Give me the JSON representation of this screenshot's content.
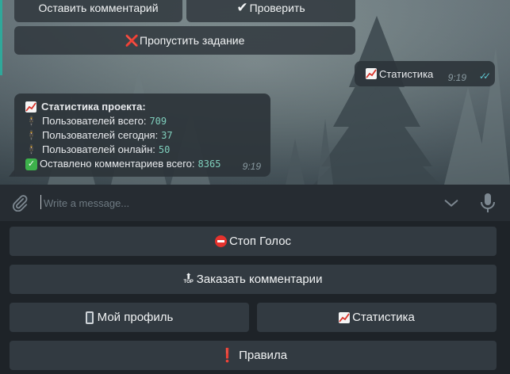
{
  "chat": {
    "inline_buttons": {
      "leave_comment": "Оставить комментарий",
      "check": "Проверить",
      "check_icon": "✔",
      "skip_task": "Пропустить задание",
      "skip_icon": "❌"
    },
    "outgoing": {
      "icon": "chart-increasing-icon",
      "text": "Статистика",
      "time": "9:19",
      "ticks": "✓✓"
    },
    "incoming": {
      "title": "Статистика проекта:",
      "rows": [
        {
          "label": "Пользователей всего:",
          "value": "709"
        },
        {
          "label": "Пользователей сегодня:",
          "value": "37"
        },
        {
          "label": "Пользователей онлайн:",
          "value": "50"
        },
        {
          "label": "Оставлено комментариев всего:",
          "value": "8365"
        }
      ],
      "time": "9:19"
    }
  },
  "composer": {
    "placeholder": "Write a message..."
  },
  "keyboard": {
    "stop_voice": "Стоп Голос",
    "order_comments": "Заказать комментарии",
    "top_label": "TOP",
    "top_arrow": "⬆",
    "my_profile": "Мой профиль",
    "statistics": "Статистика",
    "rules": "Правила",
    "rules_icon": "❗"
  },
  "colors": {
    "accent": "#2fa89a",
    "value_green": "#7fcfbc",
    "button_bg": "#323a41",
    "panel_bg": "#1e2328"
  }
}
